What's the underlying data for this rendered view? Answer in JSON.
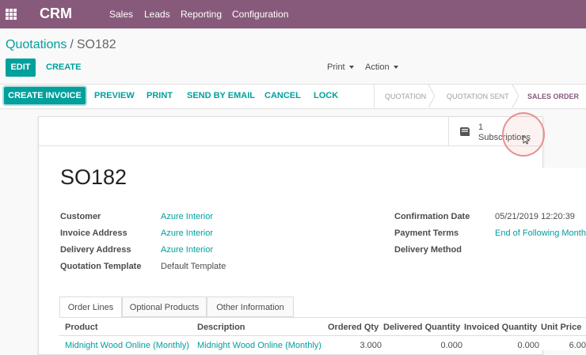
{
  "topbar": {
    "brand": "CRM",
    "menu": [
      "Sales",
      "Leads",
      "Reporting",
      "Configuration"
    ]
  },
  "breadcrumb": {
    "parent": "Quotations",
    "separator": "/",
    "current": "SO182"
  },
  "control": {
    "edit": "EDIT",
    "create": "CREATE",
    "print_dd": "Print",
    "action_dd": "Action"
  },
  "actions": {
    "create_invoice": "CREATE INVOICE",
    "preview": "PREVIEW",
    "print": "PRINT",
    "send_email": "SEND BY EMAIL",
    "cancel": "CANCEL",
    "lock": "LOCK"
  },
  "stages": [
    {
      "label": "QUOTATION",
      "active": false
    },
    {
      "label": "QUOTATION SENT",
      "active": false
    },
    {
      "label": "SALES ORDER",
      "active": true
    }
  ],
  "smart_button": {
    "count": "1",
    "label": "Subscriptions",
    "icon": "book-icon"
  },
  "record": {
    "name": "SO182",
    "left_fields": [
      {
        "label": "Customer",
        "value": "Azure Interior"
      },
      {
        "label": "Invoice Address",
        "value": "Azure Interior"
      },
      {
        "label": "Delivery Address",
        "value": "Azure Interior"
      },
      {
        "label": "Quotation Template",
        "value": "Default Template"
      }
    ],
    "right_fields": [
      {
        "label": "Confirmation Date",
        "value": "05/21/2019 12:20:39"
      },
      {
        "label": "Payment Terms",
        "value": "End of Following Month"
      },
      {
        "label": "Delivery Method",
        "value": ""
      }
    ]
  },
  "tabs": [
    "Order Lines",
    "Optional Products",
    "Other Information"
  ],
  "order_lines": {
    "headers": [
      "Product",
      "Description",
      "Ordered Qty",
      "Delivered Quantity",
      "Invoiced Quantity",
      "Unit Price"
    ],
    "rows": [
      [
        "Midnight Wood Online (Monthly)",
        "Midnight Wood Online (Monthly)",
        "3.000",
        "0.000",
        "0.000",
        "6.00"
      ]
    ]
  },
  "colors": {
    "brand": "#875a7b",
    "accent": "#00a09d",
    "highlight_ring": "#e8908e"
  }
}
